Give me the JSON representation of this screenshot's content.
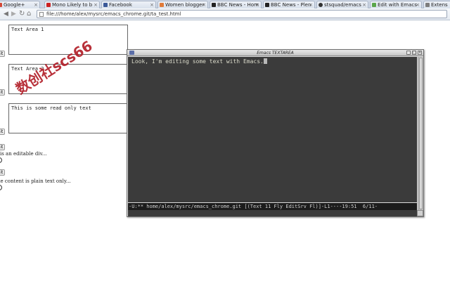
{
  "browser": {
    "tabs": [
      {
        "label": "Google+",
        "fav": "#d34836"
      },
      {
        "label": "Mono Likely to b",
        "fav": "#cc2222"
      },
      {
        "label": "Facebook",
        "fav": "#3b5998"
      },
      {
        "label": "Women blogger",
        "fav": "#e07b39"
      },
      {
        "label": "BBC News - Hom",
        "fav": "#222222"
      },
      {
        "label": "BBC News - Plen",
        "fav": "#222222"
      },
      {
        "label": "stsquad/emacs",
        "fav": "#333333"
      },
      {
        "label": "Edit with Emacs",
        "fav": "#5aa64a"
      },
      {
        "label": "Extens",
        "fav": "#7d7d7d"
      }
    ],
    "url": "file:///home/alex/mysrc/emacs_chrome.git/ta_test.html",
    "back_icon": "arrow-left-icon",
    "forward_icon": "arrow-right-icon",
    "reload_icon": "reload-icon",
    "home_icon": "home-icon"
  },
  "page": {
    "textarea1": "Text Area 1",
    "textarea2": "Text Area 2",
    "textarea3": "This is some read only text",
    "edit_label": "edit",
    "line1": "is an editable div...",
    "line2": "ne content is plain text only..."
  },
  "watermark": "数创社scs66",
  "emacs": {
    "title": "Emacs TEXTAREA",
    "buffer_text": "Look, I'm editing some text with Emacs.",
    "modeline": "-U:** home/alex/mysrc/emacs_chrome.git [(Text 11 Fly EditSrv Fl)]-L1----19:51  6/11-",
    "minimize": "_",
    "maximize": "□",
    "close": "×"
  }
}
